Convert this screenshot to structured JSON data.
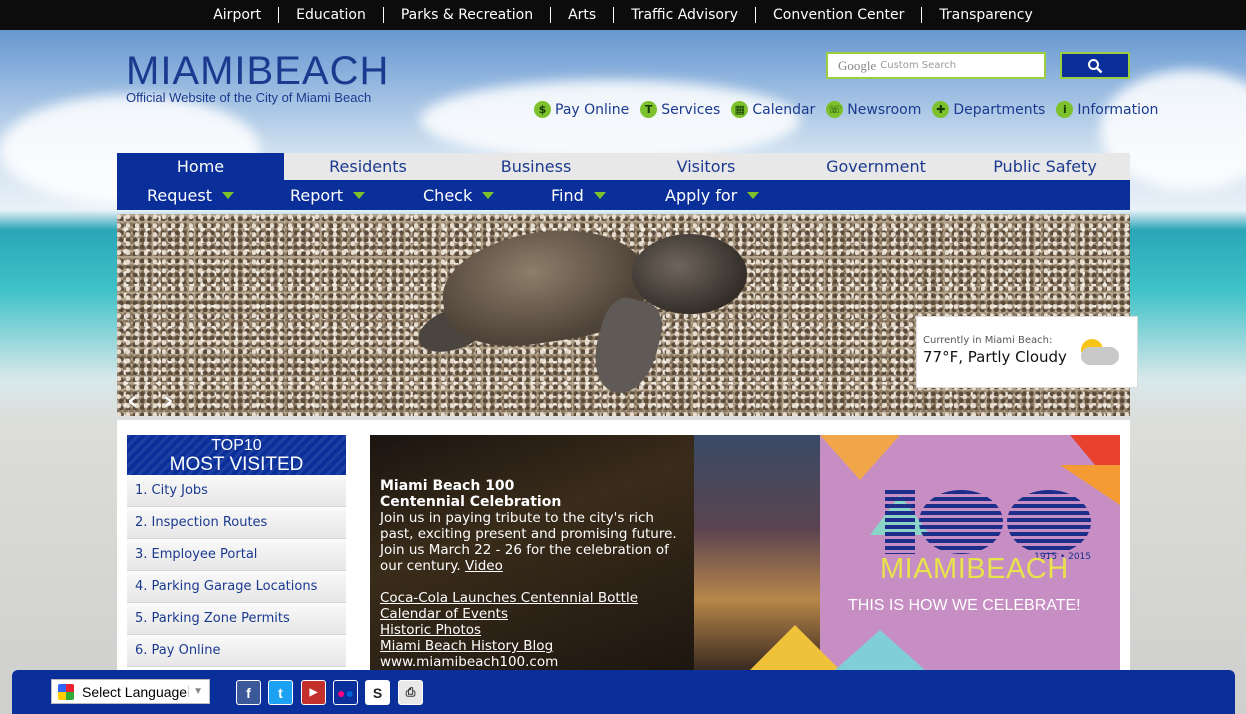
{
  "topbar": {
    "links": [
      "Airport",
      "Education",
      "Parks & Recreation",
      "Arts",
      "Traffic Advisory",
      "Convention Center",
      "Transparency"
    ]
  },
  "logo": {
    "main_a": "MIAMI",
    "main_b": "BEACH",
    "sub": "Official Website of the City of Miami Beach"
  },
  "search": {
    "google": "Google",
    "placeholder": "Custom Search"
  },
  "quicklinks": [
    {
      "label": "Pay Online",
      "icon": "$"
    },
    {
      "label": "Services",
      "icon": "T"
    },
    {
      "label": "Calendar",
      "icon": "▦"
    },
    {
      "label": "Newsroom",
      "icon": "☏"
    },
    {
      "label": "Departments",
      "icon": "✚"
    },
    {
      "label": "Information",
      "icon": "i"
    }
  ],
  "mainnav": [
    "Home",
    "Residents",
    "Business",
    "Visitors",
    "Government",
    "Public Safety"
  ],
  "subnav": [
    "Request",
    "Report",
    "Check",
    "Find",
    "Apply for"
  ],
  "weather": {
    "label": "Currently in Miami Beach:",
    "value": "77°F, Partly Cloudy"
  },
  "top10": {
    "title1": "TOP10",
    "title2": "MOST VISITED",
    "items": [
      "1. City Jobs",
      "2. Inspection Routes",
      "3. Employee Portal",
      "4. Parking Garage Locations",
      "5. Parking Zone Permits",
      "6. Pay Online"
    ]
  },
  "promo": {
    "heading1": "Miami Beach 100",
    "heading2": "Centennial Celebration",
    "body": "Join us in paying tribute to the city's rich past, exciting present and promising future. Join us March 22 - 26 for the celebration of our century.",
    "video": "Video",
    "links": [
      "Coca-Cola Launches Centennial Bottle",
      "Calendar of Events",
      "Historic Photos",
      "Miami Beach History Blog"
    ],
    "url": "www.miamibeach100.com",
    "years": "1915 • 2015",
    "brand": "MIAMIBEACH",
    "tagline": "THIS IS HOW WE CELEBRATE!"
  },
  "footer": {
    "language": "Select Language"
  }
}
